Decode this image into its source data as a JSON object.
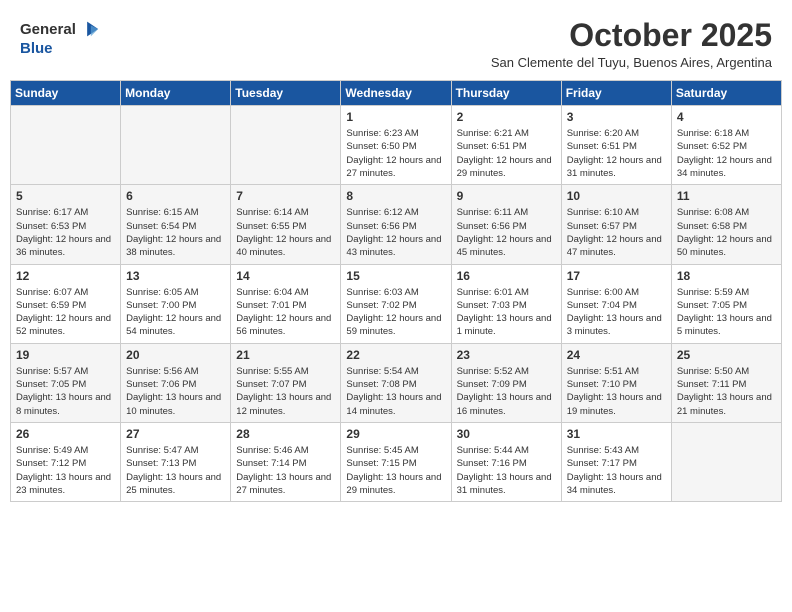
{
  "header": {
    "logo_general": "General",
    "logo_blue": "Blue",
    "month_title": "October 2025",
    "subtitle": "San Clemente del Tuyu, Buenos Aires, Argentina"
  },
  "days_of_week": [
    "Sunday",
    "Monday",
    "Tuesday",
    "Wednesday",
    "Thursday",
    "Friday",
    "Saturday"
  ],
  "weeks": [
    [
      {
        "day": "",
        "sunrise": "",
        "sunset": "",
        "daylight": "",
        "empty": true
      },
      {
        "day": "",
        "sunrise": "",
        "sunset": "",
        "daylight": "",
        "empty": true
      },
      {
        "day": "",
        "sunrise": "",
        "sunset": "",
        "daylight": "",
        "empty": true
      },
      {
        "day": "1",
        "sunrise": "Sunrise: 6:23 AM",
        "sunset": "Sunset: 6:50 PM",
        "daylight": "Daylight: 12 hours and 27 minutes."
      },
      {
        "day": "2",
        "sunrise": "Sunrise: 6:21 AM",
        "sunset": "Sunset: 6:51 PM",
        "daylight": "Daylight: 12 hours and 29 minutes."
      },
      {
        "day": "3",
        "sunrise": "Sunrise: 6:20 AM",
        "sunset": "Sunset: 6:51 PM",
        "daylight": "Daylight: 12 hours and 31 minutes."
      },
      {
        "day": "4",
        "sunrise": "Sunrise: 6:18 AM",
        "sunset": "Sunset: 6:52 PM",
        "daylight": "Daylight: 12 hours and 34 minutes."
      }
    ],
    [
      {
        "day": "5",
        "sunrise": "Sunrise: 6:17 AM",
        "sunset": "Sunset: 6:53 PM",
        "daylight": "Daylight: 12 hours and 36 minutes."
      },
      {
        "day": "6",
        "sunrise": "Sunrise: 6:15 AM",
        "sunset": "Sunset: 6:54 PM",
        "daylight": "Daylight: 12 hours and 38 minutes."
      },
      {
        "day": "7",
        "sunrise": "Sunrise: 6:14 AM",
        "sunset": "Sunset: 6:55 PM",
        "daylight": "Daylight: 12 hours and 40 minutes."
      },
      {
        "day": "8",
        "sunrise": "Sunrise: 6:12 AM",
        "sunset": "Sunset: 6:56 PM",
        "daylight": "Daylight: 12 hours and 43 minutes."
      },
      {
        "day": "9",
        "sunrise": "Sunrise: 6:11 AM",
        "sunset": "Sunset: 6:56 PM",
        "daylight": "Daylight: 12 hours and 45 minutes."
      },
      {
        "day": "10",
        "sunrise": "Sunrise: 6:10 AM",
        "sunset": "Sunset: 6:57 PM",
        "daylight": "Daylight: 12 hours and 47 minutes."
      },
      {
        "day": "11",
        "sunrise": "Sunrise: 6:08 AM",
        "sunset": "Sunset: 6:58 PM",
        "daylight": "Daylight: 12 hours and 50 minutes."
      }
    ],
    [
      {
        "day": "12",
        "sunrise": "Sunrise: 6:07 AM",
        "sunset": "Sunset: 6:59 PM",
        "daylight": "Daylight: 12 hours and 52 minutes."
      },
      {
        "day": "13",
        "sunrise": "Sunrise: 6:05 AM",
        "sunset": "Sunset: 7:00 PM",
        "daylight": "Daylight: 12 hours and 54 minutes."
      },
      {
        "day": "14",
        "sunrise": "Sunrise: 6:04 AM",
        "sunset": "Sunset: 7:01 PM",
        "daylight": "Daylight: 12 hours and 56 minutes."
      },
      {
        "day": "15",
        "sunrise": "Sunrise: 6:03 AM",
        "sunset": "Sunset: 7:02 PM",
        "daylight": "Daylight: 12 hours and 59 minutes."
      },
      {
        "day": "16",
        "sunrise": "Sunrise: 6:01 AM",
        "sunset": "Sunset: 7:03 PM",
        "daylight": "Daylight: 13 hours and 1 minute."
      },
      {
        "day": "17",
        "sunrise": "Sunrise: 6:00 AM",
        "sunset": "Sunset: 7:04 PM",
        "daylight": "Daylight: 13 hours and 3 minutes."
      },
      {
        "day": "18",
        "sunrise": "Sunrise: 5:59 AM",
        "sunset": "Sunset: 7:05 PM",
        "daylight": "Daylight: 13 hours and 5 minutes."
      }
    ],
    [
      {
        "day": "19",
        "sunrise": "Sunrise: 5:57 AM",
        "sunset": "Sunset: 7:05 PM",
        "daylight": "Daylight: 13 hours and 8 minutes."
      },
      {
        "day": "20",
        "sunrise": "Sunrise: 5:56 AM",
        "sunset": "Sunset: 7:06 PM",
        "daylight": "Daylight: 13 hours and 10 minutes."
      },
      {
        "day": "21",
        "sunrise": "Sunrise: 5:55 AM",
        "sunset": "Sunset: 7:07 PM",
        "daylight": "Daylight: 13 hours and 12 minutes."
      },
      {
        "day": "22",
        "sunrise": "Sunrise: 5:54 AM",
        "sunset": "Sunset: 7:08 PM",
        "daylight": "Daylight: 13 hours and 14 minutes."
      },
      {
        "day": "23",
        "sunrise": "Sunrise: 5:52 AM",
        "sunset": "Sunset: 7:09 PM",
        "daylight": "Daylight: 13 hours and 16 minutes."
      },
      {
        "day": "24",
        "sunrise": "Sunrise: 5:51 AM",
        "sunset": "Sunset: 7:10 PM",
        "daylight": "Daylight: 13 hours and 19 minutes."
      },
      {
        "day": "25",
        "sunrise": "Sunrise: 5:50 AM",
        "sunset": "Sunset: 7:11 PM",
        "daylight": "Daylight: 13 hours and 21 minutes."
      }
    ],
    [
      {
        "day": "26",
        "sunrise": "Sunrise: 5:49 AM",
        "sunset": "Sunset: 7:12 PM",
        "daylight": "Daylight: 13 hours and 23 minutes."
      },
      {
        "day": "27",
        "sunrise": "Sunrise: 5:47 AM",
        "sunset": "Sunset: 7:13 PM",
        "daylight": "Daylight: 13 hours and 25 minutes."
      },
      {
        "day": "28",
        "sunrise": "Sunrise: 5:46 AM",
        "sunset": "Sunset: 7:14 PM",
        "daylight": "Daylight: 13 hours and 27 minutes."
      },
      {
        "day": "29",
        "sunrise": "Sunrise: 5:45 AM",
        "sunset": "Sunset: 7:15 PM",
        "daylight": "Daylight: 13 hours and 29 minutes."
      },
      {
        "day": "30",
        "sunrise": "Sunrise: 5:44 AM",
        "sunset": "Sunset: 7:16 PM",
        "daylight": "Daylight: 13 hours and 31 minutes."
      },
      {
        "day": "31",
        "sunrise": "Sunrise: 5:43 AM",
        "sunset": "Sunset: 7:17 PM",
        "daylight": "Daylight: 13 hours and 34 minutes."
      },
      {
        "day": "",
        "sunrise": "",
        "sunset": "",
        "daylight": "",
        "empty": true
      }
    ]
  ]
}
